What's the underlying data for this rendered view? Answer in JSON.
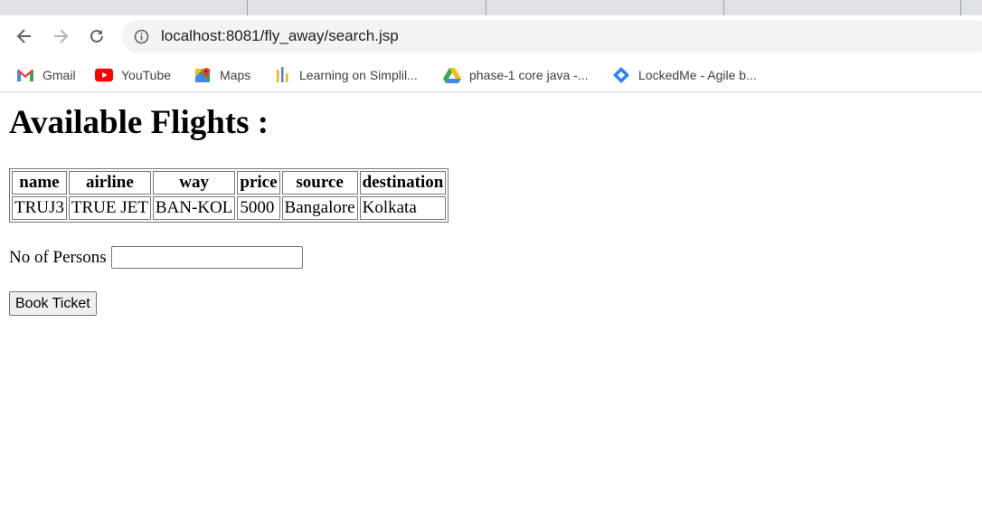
{
  "browser": {
    "url": "localhost:8081/fly_away/search.jsp",
    "bookmarks": [
      {
        "label": "Gmail",
        "icon": "gmail-icon"
      },
      {
        "label": "YouTube",
        "icon": "youtube-icon"
      },
      {
        "label": "Maps",
        "icon": "maps-icon"
      },
      {
        "label": "Learning on Simplil...",
        "icon": "simplilearn-icon"
      },
      {
        "label": "phase-1 core java -...",
        "icon": "google-drive-icon"
      },
      {
        "label": "LockedMe - Agile b...",
        "icon": "jira-icon"
      }
    ]
  },
  "page": {
    "title": "Available Flights :",
    "table": {
      "headers": [
        "name",
        "airline",
        "way",
        "price",
        "source",
        "destination"
      ],
      "rows": [
        [
          "TRUJ3",
          "TRUE JET",
          "BAN-KOL",
          "5000",
          "Bangalore",
          "Kolkata"
        ]
      ]
    },
    "persons_label": "No of Persons",
    "persons_value": "",
    "book_button": "Book Ticket"
  }
}
